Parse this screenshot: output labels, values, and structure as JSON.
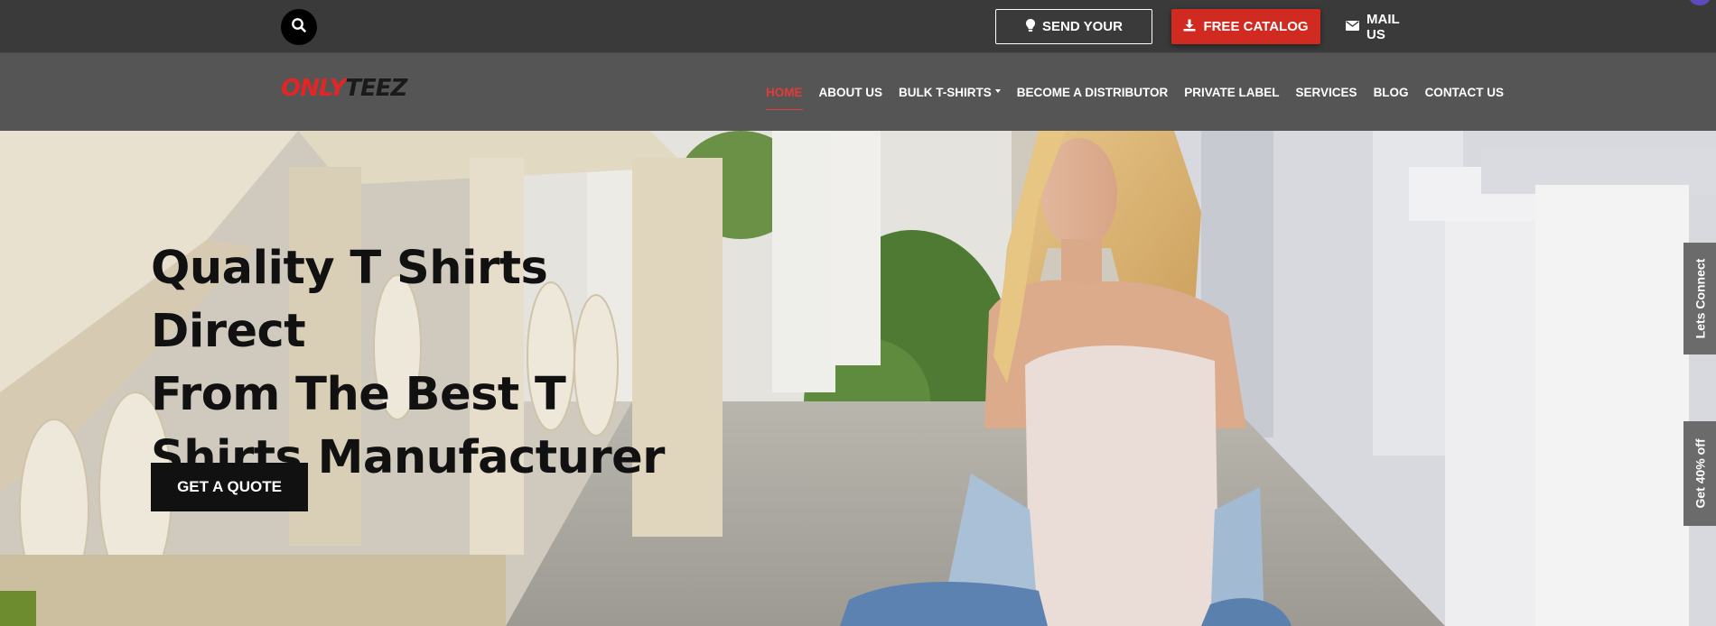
{
  "topbar": {
    "send_label": "SEND YOUR",
    "catalog_label": "FREE CATALOG",
    "mail_label": "MAIL US",
    "icons": {
      "search": "search-icon",
      "send": "lightbulb-icon",
      "catalog": "download-icon",
      "mail": "envelope-icon"
    },
    "colors": {
      "background": "#3a3a3a",
      "catalog_button": "#d12a20"
    }
  },
  "brand": {
    "logo_part1": "ONLY",
    "logo_part2": "TEEZ",
    "colors": {
      "part1": "#e22626",
      "part2": "#1a1a1a"
    }
  },
  "nav": {
    "background": "#555555",
    "active_color": "#e43a3a",
    "items": [
      {
        "label": "HOME",
        "active": true
      },
      {
        "label": "ABOUT US"
      },
      {
        "label": "BULK T-SHIRTS",
        "has_dropdown": true
      },
      {
        "label": "BECOME A DISTRIBUTOR"
      },
      {
        "label": "PRIVATE LABEL"
      },
      {
        "label": "SERVICES"
      },
      {
        "label": "BLOG"
      },
      {
        "label": "CONTACT US"
      }
    ]
  },
  "hero": {
    "title_line1": "Quality T Shirts Direct",
    "title_line2": "From The Best T",
    "title_line3": "Shirts Manufacturer",
    "cta_label": "GET A QUOTE"
  },
  "side_tabs": {
    "connect_label": "Lets Connect",
    "offer_label": "Get 40% off"
  }
}
